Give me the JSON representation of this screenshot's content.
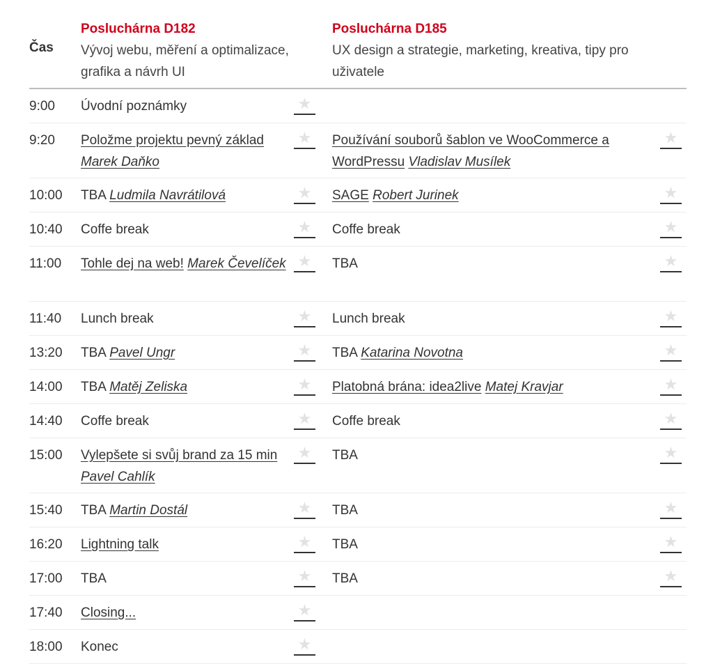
{
  "header": {
    "time_label": "Čas",
    "rooms": [
      {
        "title": "Posluchárna D182",
        "description": "Vývoj webu, měření a optimalizace, grafika a návrh UI"
      },
      {
        "title": "Posluchárna D185",
        "description": "UX design a strategie, marketing, kreativa, tipy pro uživatele"
      }
    ]
  },
  "colors": {
    "accent": "#d0021b",
    "star": "#e2e2e2"
  },
  "star_icon": "★",
  "rows": [
    {
      "time": "9:00",
      "lines": 1,
      "d182": {
        "title": "Úvodní poznámky",
        "link": false,
        "speaker": ""
      },
      "d185": null
    },
    {
      "time": "9:20",
      "lines": 2,
      "d182": {
        "title": "Položme projektu pevný základ",
        "link": true,
        "speaker": "Marek Daňko"
      },
      "d185": {
        "title": "Používání souborů šablon ve WooCommerce a WordPressu",
        "link": true,
        "speaker": "Vladislav Musílek"
      }
    },
    {
      "time": "10:00",
      "lines": 1,
      "d182": {
        "title": "TBA",
        "link": false,
        "speaker": "Ludmila Navrátilová"
      },
      "d185": {
        "title": "SAGE",
        "link": true,
        "speaker": "Robert Jurinek"
      }
    },
    {
      "time": "10:40",
      "lines": 1,
      "d182": {
        "title": "Coffe break",
        "link": false,
        "speaker": ""
      },
      "d185": {
        "title": "Coffe break",
        "link": false,
        "speaker": ""
      }
    },
    {
      "time": "11:00",
      "lines": 2,
      "d182": {
        "title": "Tohle dej na web!",
        "link": true,
        "speaker": "Marek Čevelíček"
      },
      "d185": {
        "title": "TBA",
        "link": false,
        "speaker": ""
      }
    },
    {
      "time": "11:40",
      "lines": 1,
      "d182": {
        "title": "Lunch break",
        "link": false,
        "speaker": ""
      },
      "d185": {
        "title": "Lunch break",
        "link": false,
        "speaker": ""
      }
    },
    {
      "time": "13:20",
      "lines": 1,
      "d182": {
        "title": "TBA",
        "link": false,
        "speaker": "Pavel Ungr"
      },
      "d185": {
        "title": "TBA",
        "link": false,
        "speaker": "Katarina Novotna"
      }
    },
    {
      "time": "14:00",
      "lines": 1,
      "d182": {
        "title": "TBA",
        "link": false,
        "speaker": "Matěj Zeliska"
      },
      "d185": {
        "title": "Platobná brána: idea2live",
        "link": true,
        "speaker": "Matej Kravjar"
      }
    },
    {
      "time": "14:40",
      "lines": 1,
      "d182": {
        "title": "Coffe break",
        "link": false,
        "speaker": ""
      },
      "d185": {
        "title": "Coffe break",
        "link": false,
        "speaker": ""
      }
    },
    {
      "time": "15:00",
      "lines": 2,
      "d182": {
        "title": "Vylepšete si svůj brand za 15 min",
        "link": true,
        "speaker": "Pavel Cahlík"
      },
      "d185": {
        "title": "TBA",
        "link": false,
        "speaker": ""
      }
    },
    {
      "time": "15:40",
      "lines": 1,
      "d182": {
        "title": "TBA",
        "link": false,
        "speaker": "Martin Dostál"
      },
      "d185": {
        "title": "TBA",
        "link": false,
        "speaker": ""
      }
    },
    {
      "time": "16:20",
      "lines": 1,
      "d182": {
        "title": "Lightning talk",
        "link": true,
        "speaker": ""
      },
      "d185": {
        "title": "TBA",
        "link": false,
        "speaker": ""
      }
    },
    {
      "time": "17:00",
      "lines": 1,
      "d182": {
        "title": "TBA",
        "link": false,
        "speaker": ""
      },
      "d185": {
        "title": "TBA",
        "link": false,
        "speaker": ""
      }
    },
    {
      "time": "17:40",
      "lines": 1,
      "d182": {
        "title": "Closing...",
        "link": true,
        "speaker": ""
      },
      "d185": null
    },
    {
      "time": "18:00",
      "lines": 1,
      "d182": {
        "title": "Konec",
        "link": false,
        "speaker": ""
      },
      "d185": null
    }
  ]
}
